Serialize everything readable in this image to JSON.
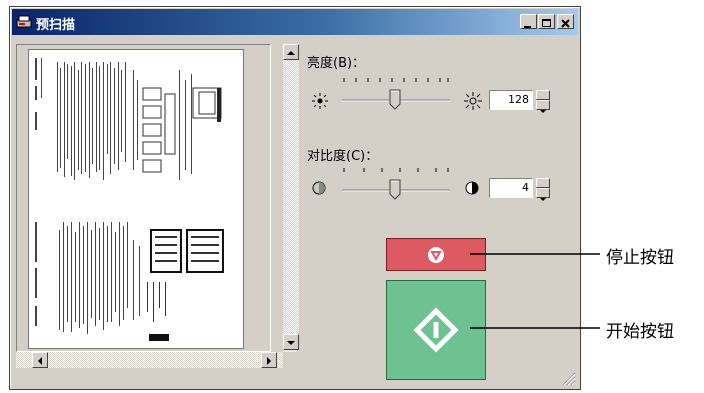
{
  "window": {
    "title": "预扫描"
  },
  "brightness": {
    "label": "亮度(B)：",
    "value": "128",
    "level_fraction": 0.33
  },
  "contrast": {
    "label": "对比度(C)：",
    "value": "4",
    "level_fraction": 0.45
  },
  "callouts": {
    "stop": "停止按钮",
    "start": "开始按钮"
  },
  "colors": {
    "stop_button": "#dd5a62",
    "start_button": "#6ec292",
    "titlebar_start": "#0a246a",
    "titlebar_end": "#a6caf0"
  }
}
